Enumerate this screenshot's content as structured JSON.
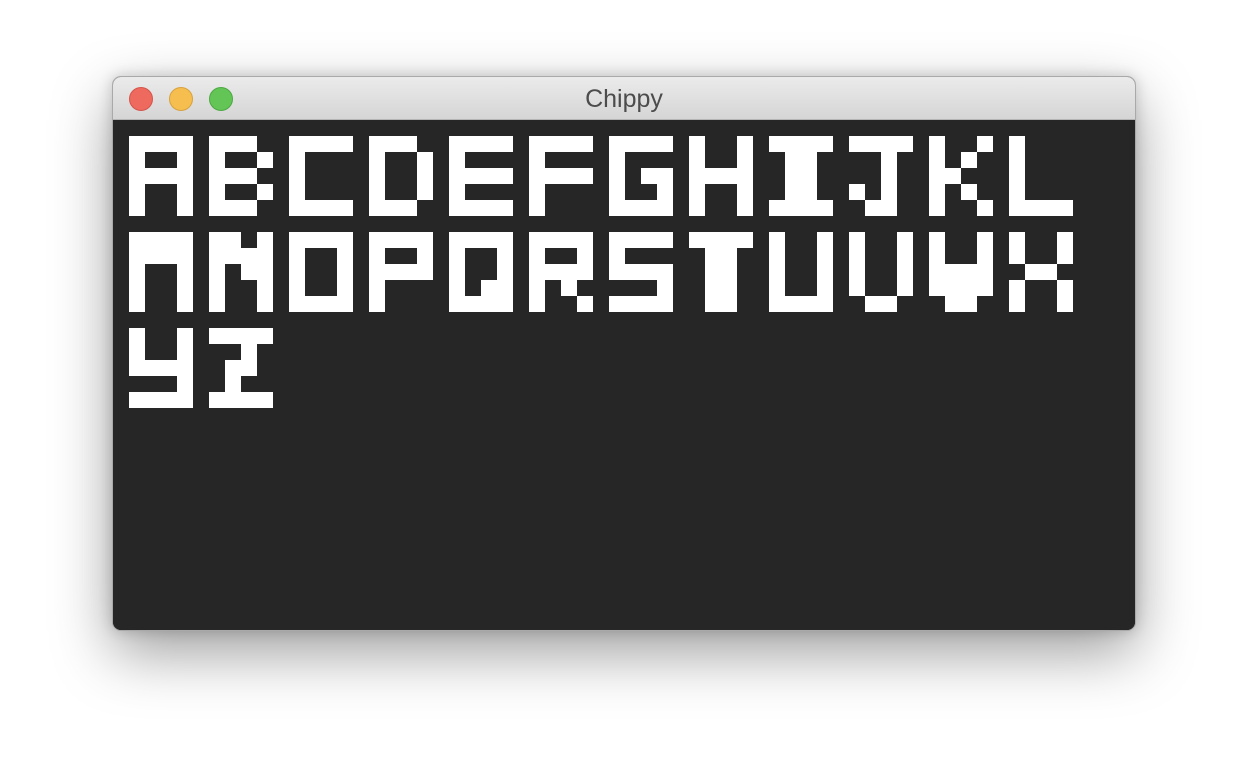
{
  "window": {
    "title": "Chippy"
  },
  "traffic_lights": {
    "close": {
      "icon": "close-icon",
      "color": "#ee6a5e"
    },
    "minimize": {
      "icon": "minimize-icon",
      "color": "#f5be4f"
    },
    "zoom": {
      "icon": "zoom-icon",
      "color": "#62c555"
    }
  },
  "display": {
    "background": "#262626",
    "pixel_color": "#ffffff",
    "rows": [
      [
        "A",
        "B",
        "C",
        "D",
        "E",
        "F",
        "G",
        "H",
        "I",
        "J",
        "K",
        "L"
      ],
      [
        "M",
        "N",
        "O",
        "P",
        "Q",
        "R",
        "S",
        "T",
        "U",
        "V",
        "W",
        "X"
      ],
      [
        "Y",
        "Z"
      ]
    ],
    "glyphs": {
      "A": [
        "1111",
        "1001",
        "1111",
        "1001",
        "1001"
      ],
      "B": [
        "1110",
        "1001",
        "1110",
        "1001",
        "1110"
      ],
      "C": [
        "1111",
        "1000",
        "1000",
        "1000",
        "1111"
      ],
      "D": [
        "1110",
        "1001",
        "1001",
        "1001",
        "1110"
      ],
      "E": [
        "1111",
        "1000",
        "1111",
        "1000",
        "1111"
      ],
      "F": [
        "1111",
        "1000",
        "1111",
        "1000",
        "1000"
      ],
      "G": [
        "1111",
        "1000",
        "1011",
        "1001",
        "1111"
      ],
      "H": [
        "1001",
        "1001",
        "1111",
        "1001",
        "1001"
      ],
      "I": [
        "1111",
        "0110",
        "0110",
        "0110",
        "1111"
      ],
      "J": [
        "1111",
        "0010",
        "0010",
        "1010",
        "0110"
      ],
      "K": [
        "1001",
        "1010",
        "1100",
        "1010",
        "1001"
      ],
      "L": [
        "1000",
        "1000",
        "1000",
        "1000",
        "1111"
      ],
      "M": [
        "1111",
        "1111",
        "1001",
        "1001",
        "1001"
      ],
      "N": [
        "1101",
        "1111",
        "1011",
        "1001",
        "1001"
      ],
      "O": [
        "1111",
        "1001",
        "1001",
        "1001",
        "1111"
      ],
      "P": [
        "1111",
        "1001",
        "1111",
        "1000",
        "1000"
      ],
      "Q": [
        "1111",
        "1001",
        "1001",
        "1011",
        "1111"
      ],
      "R": [
        "1111",
        "1001",
        "1111",
        "1010",
        "1001"
      ],
      "S": [
        "1111",
        "1000",
        "1111",
        "0001",
        "1111"
      ],
      "T": [
        "1111",
        "0110",
        "0110",
        "0110",
        "0110"
      ],
      "U": [
        "1001",
        "1001",
        "1001",
        "1001",
        "1111"
      ],
      "V": [
        "1001",
        "1001",
        "1001",
        "1001",
        "0110"
      ],
      "W": [
        "1001",
        "1001",
        "1111",
        "1111",
        "0110"
      ],
      "X": [
        "1001",
        "1001",
        "0110",
        "1001",
        "1001"
      ],
      "Y": [
        "1001",
        "1001",
        "1111",
        "0001",
        "1111"
      ],
      "Z": [
        "1111",
        "0010",
        "0110",
        "0100",
        "1111"
      ]
    }
  }
}
